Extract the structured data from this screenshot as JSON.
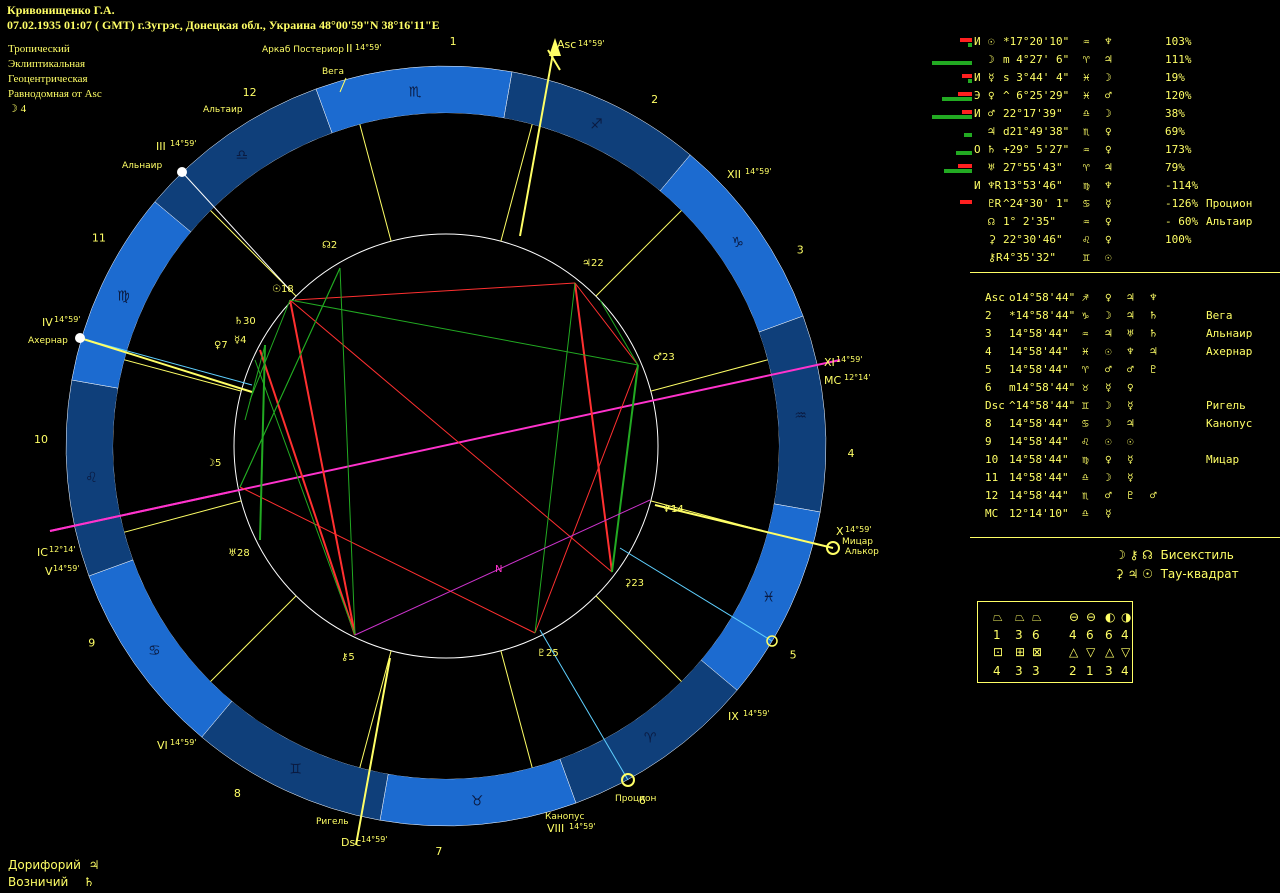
{
  "header": {
    "name": "Кривонищенко Г.А.",
    "datetime_place": "07.02.1935  01:07 ( GMT) г.Зугрэс, Донецкая обл., Украина 48°00'59\"N  38°16'11\"E"
  },
  "settings": [
    "Тропический",
    "Эклиптикальная",
    "Геоцентрическая",
    "Равнодомная от Asc"
  ],
  "moon_info": "☽  4",
  "chart_labels": {
    "house_numbers": [
      "1",
      "2",
      "3",
      "4",
      "5",
      "6",
      "7",
      "8",
      "9",
      "10",
      "11",
      "12"
    ],
    "signs": [
      "♐",
      "♑",
      "♒",
      "♓",
      "♈",
      "♉",
      "♊",
      "♋",
      "♌",
      "♍",
      "♎",
      "♏"
    ],
    "cusps": {
      "asc": "Asc",
      "asc_deg": "14°59'",
      "ii": "II",
      "ii_deg": "14°59'",
      "iii": "III",
      "iii_deg": "14°59'",
      "iv": "IV",
      "iv_deg": "14°59'",
      "ic": "IC",
      "ic_deg": "12°14'",
      "v": "V",
      "v_deg": "14°59'",
      "vi": "VI",
      "vi_deg": "14°59'",
      "dsc": "Dsc",
      "dsc_deg": "14°59'",
      "viii": "VIII",
      "viii_deg": "14°59'",
      "ix": "IX",
      "ix_deg": "14°59'",
      "x": "X",
      "x_deg": "14°59'",
      "mc": "MC",
      "mc_deg": "12°14'",
      "xi": "XI",
      "xi_deg": "14°59'",
      "xii": "XII",
      "xii_deg": "14°59'"
    },
    "stars": {
      "arkab": "Аркаб Постериор",
      "vega": "Вега",
      "altair": "Альтаир",
      "alnair": "Альнаир",
      "achernar": "Ахернар",
      "rigel": "Ригель",
      "canopus": "Канопус",
      "procyon": "Процион",
      "mizar": "Мицар",
      "alcor": "Алькор"
    },
    "planets": {
      "node2": "☊2",
      "jup22": "♃22",
      "sun18": "☉18",
      "sat30": "♄30",
      "ven7": "♀7",
      "merc4": "☿4",
      "mars23": "♂23",
      "moon5": "☽5",
      "uran28": "♅28",
      "nep14": "♆14",
      "cer23": "⚳23",
      "chir5": "⚷5",
      "pl25": "♇25",
      "node_s": "N"
    }
  },
  "planet_table": [
    {
      "mark": "И",
      "sym": "☉",
      "pos": "*17°20'10\"",
      "sign": "♒",
      "ruler": "♆",
      "pct": "103%"
    },
    {
      "mark": "",
      "sym": "☽",
      "pos": "m 4°27' 6\"",
      "sign": "♈",
      "ruler": "♃",
      "pct": "111%"
    },
    {
      "mark": "И",
      "sym": "☿",
      "pos": "s 3°44' 4\"",
      "sign": "♓",
      "ruler": "☽",
      "pct": "19%"
    },
    {
      "mark": "Э",
      "sym": "♀",
      "pos": "^ 6°25'29\"",
      "sign": "♓",
      "ruler": "♂",
      "pct": "120%"
    },
    {
      "mark": "И",
      "sym": "♂",
      "pos": " 22°17'39\"",
      "sign": "♎",
      "ruler": "☽",
      "pct": "38%"
    },
    {
      "mark": "",
      "sym": "♃",
      "pos": "d21°49'38\"",
      "sign": "♏",
      "ruler": "♀",
      "pct": "69%"
    },
    {
      "mark": "О",
      "sym": "♄",
      "pos": "+29° 5'27\"",
      "sign": "♒",
      "ruler": "♀",
      "pct": "173%"
    },
    {
      "mark": "",
      "sym": "♅",
      "pos": " 27°55'43\"",
      "sign": "♈",
      "ruler": "♃",
      "pct": "79%"
    },
    {
      "mark": "И",
      "sym": "♆R",
      "pos": " 13°53'46\"",
      "sign": "♍",
      "ruler": "♆",
      "pct": "-114%"
    },
    {
      "mark": "",
      "sym": "♇R",
      "pos": "^24°30' 1\"",
      "sign": "♋",
      "ruler": "☿",
      "pct": "-126%",
      "star": "Процион"
    },
    {
      "mark": "",
      "sym": "☊",
      "pos": "  1° 2'35\"",
      "sign": "♒",
      "ruler": "♀",
      "pct": "- 60%",
      "star": "Альтаир"
    },
    {
      "mark": "",
      "sym": "⚳",
      "pos": " 22°30'46\"",
      "sign": "♌",
      "ruler": "♀",
      "pct": "100%"
    },
    {
      "mark": "",
      "sym": "⚷R",
      "pos": "  4°35'32\"",
      "sign": "♊",
      "ruler": "☉",
      "pct": ""
    }
  ],
  "house_table": [
    {
      "h": "Asc",
      "pos": "o14°58'44\"",
      "sign": "♐",
      "r": [
        "♀",
        "♃",
        "♆"
      ],
      "star": ""
    },
    {
      "h": "2",
      "pos": "*14°58'44\"",
      "sign": "♑",
      "r": [
        "☽",
        "♃",
        "♄"
      ],
      "star": "Вега"
    },
    {
      "h": "3",
      "pos": " 14°58'44\"",
      "sign": "♒",
      "r": [
        "♃",
        "♅",
        "♄"
      ],
      "star": "Альнаир"
    },
    {
      "h": "4",
      "pos": " 14°58'44\"",
      "sign": "♓",
      "r": [
        "☉",
        "♆",
        "♃"
      ],
      "star": "Ахернар"
    },
    {
      "h": "5",
      "pos": " 14°58'44\"",
      "sign": "♈",
      "r": [
        "♂",
        "♂",
        "♇"
      ],
      "star": ""
    },
    {
      "h": "6",
      "pos": "m14°58'44\"",
      "sign": "♉",
      "r": [
        "☿",
        "♀",
        ""
      ],
      "star": ""
    },
    {
      "h": "Dsc",
      "pos": "^14°58'44\"",
      "sign": "♊",
      "r": [
        "☽",
        "☿",
        ""
      ],
      "star": "Ригель"
    },
    {
      "h": "8",
      "pos": " 14°58'44\"",
      "sign": "♋",
      "r": [
        "☽",
        "♃",
        ""
      ],
      "star": "Канопус"
    },
    {
      "h": "9",
      "pos": " 14°58'44\"",
      "sign": "♌",
      "r": [
        "☉",
        "☉",
        ""
      ],
      "star": ""
    },
    {
      "h": "10",
      "pos": " 14°58'44\"",
      "sign": "♍",
      "r": [
        "♀",
        "☿",
        ""
      ],
      "star": "Мицар"
    },
    {
      "h": "11",
      "pos": " 14°58'44\"",
      "sign": "♎",
      "r": [
        "☽",
        "☿",
        ""
      ],
      "star": ""
    },
    {
      "h": "12",
      "pos": " 14°58'44\"",
      "sign": "♏",
      "r": [
        "♂",
        "♇",
        "♂"
      ],
      "star": ""
    },
    {
      "h": "MC",
      "pos": " 12°14'10\"",
      "sign": "♎",
      "r": [
        "☿",
        "",
        ""
      ],
      "star": ""
    }
  ],
  "configurations": [
    {
      "syms": "☽ ⚷ ☊",
      "name": "Бисекстиль"
    },
    {
      "syms": "⚳ ♃ ☉",
      "name": "Тау-квадрат"
    }
  ],
  "element_box": {
    "row1_syms": [
      "⏢",
      "⏢",
      "⏢",
      "⊖",
      "⊖",
      "◐",
      "◑"
    ],
    "row1_vals": [
      "1",
      "3",
      "6",
      "4",
      "6",
      "6",
      "4"
    ],
    "row2_syms": [
      "⊡",
      "⊞",
      "⊠",
      "△",
      "▽",
      "△",
      "▽"
    ],
    "row2_vals": [
      "4",
      "3",
      "3",
      "2",
      "1",
      "3",
      "4"
    ]
  },
  "footer": {
    "doryphory_label": "Дорифорий",
    "doryphory_sym": "♃",
    "vozn_label": "Возничий",
    "vozn_sym": "♄"
  }
}
